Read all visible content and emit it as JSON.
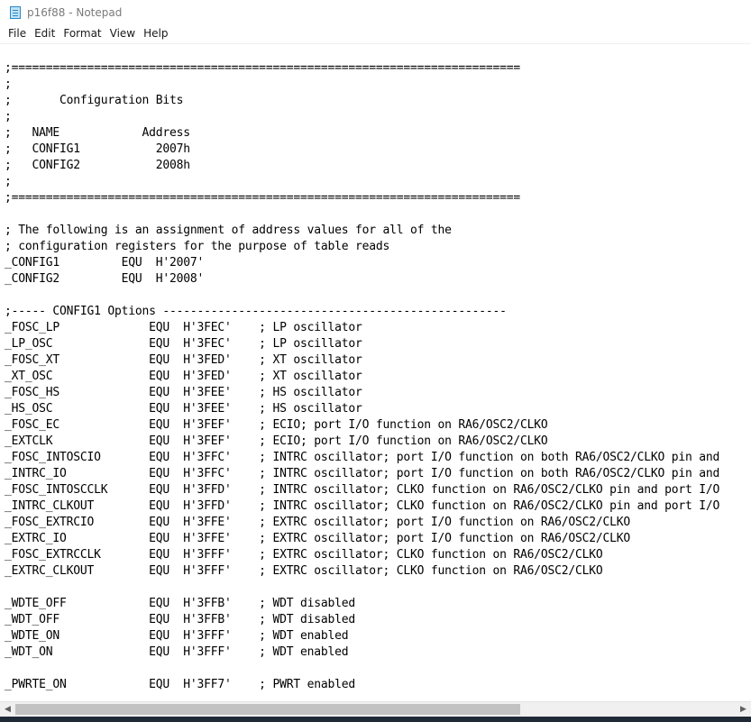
{
  "window": {
    "title": "p16f88 - Notepad"
  },
  "menu": {
    "items": [
      "File",
      "Edit",
      "Format",
      "View",
      "Help"
    ]
  },
  "editor": {
    "lines": [
      ";==========================================================================",
      ";",
      ";       Configuration Bits",
      ";",
      ";   NAME            Address",
      ";   CONFIG1           2007h",
      ";   CONFIG2           2008h",
      ";",
      ";==========================================================================",
      "",
      "; The following is an assignment of address values for all of the",
      "; configuration registers for the purpose of table reads",
      "_CONFIG1         EQU  H'2007'",
      "_CONFIG2         EQU  H'2008'",
      "",
      ";----- CONFIG1 Options --------------------------------------------------",
      "_FOSC_LP             EQU  H'3FEC'    ; LP oscillator",
      "_LP_OSC              EQU  H'3FEC'    ; LP oscillator",
      "_FOSC_XT             EQU  H'3FED'    ; XT oscillator",
      "_XT_OSC              EQU  H'3FED'    ; XT oscillator",
      "_FOSC_HS             EQU  H'3FEE'    ; HS oscillator",
      "_HS_OSC              EQU  H'3FEE'    ; HS oscillator",
      "_FOSC_EC             EQU  H'3FEF'    ; ECIO; port I/O function on RA6/OSC2/CLKO",
      "_EXTCLK              EQU  H'3FEF'    ; ECIO; port I/O function on RA6/OSC2/CLKO",
      "_FOSC_INTOSCIO       EQU  H'3FFC'    ; INTRC oscillator; port I/O function on both RA6/OSC2/CLKO pin and",
      "_INTRC_IO            EQU  H'3FFC'    ; INTRC oscillator; port I/O function on both RA6/OSC2/CLKO pin and",
      "_FOSC_INTOSCCLK      EQU  H'3FFD'    ; INTRC oscillator; CLKO function on RA6/OSC2/CLKO pin and port I/O",
      "_INTRC_CLKOUT        EQU  H'3FFD'    ; INTRC oscillator; CLKO function on RA6/OSC2/CLKO pin and port I/O",
      "_FOSC_EXTRCIO        EQU  H'3FFE'    ; EXTRC oscillator; port I/O function on RA6/OSC2/CLKO",
      "_EXTRC_IO            EQU  H'3FFE'    ; EXTRC oscillator; port I/O function on RA6/OSC2/CLKO",
      "_FOSC_EXTRCCLK       EQU  H'3FFF'    ; EXTRC oscillator; CLKO function on RA6/OSC2/CLKO",
      "_EXTRC_CLKOUT        EQU  H'3FFF'    ; EXTRC oscillator; CLKO function on RA6/OSC2/CLKO",
      "",
      "_WDTE_OFF            EQU  H'3FFB'    ; WDT disabled",
      "_WDT_OFF             EQU  H'3FFB'    ; WDT disabled",
      "_WDTE_ON             EQU  H'3FFF'    ; WDT enabled",
      "_WDT_ON              EQU  H'3FFF'    ; WDT enabled",
      "",
      "_PWRTE_ON            EQU  H'3FF7'    ; PWRT enabled"
    ]
  }
}
